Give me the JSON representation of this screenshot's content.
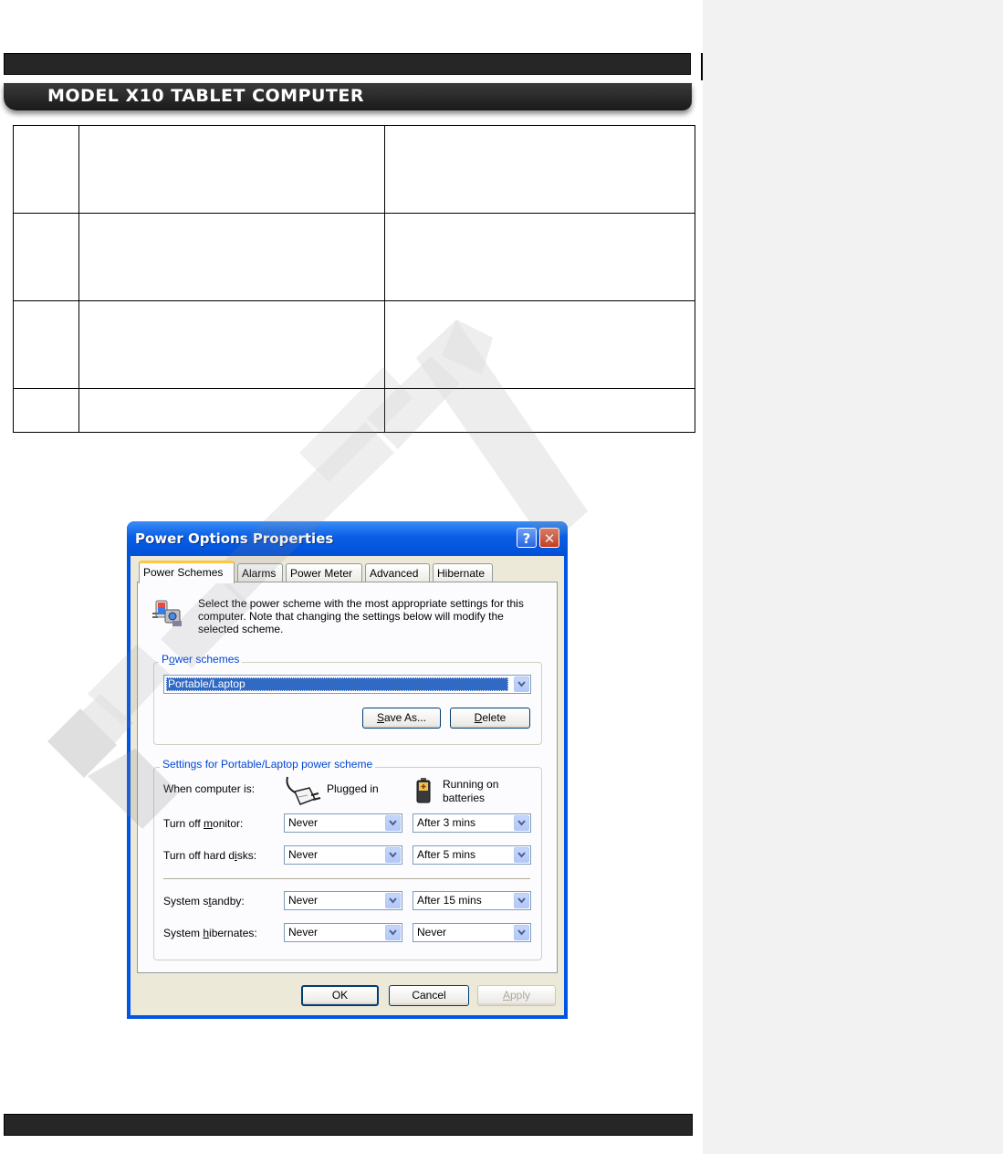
{
  "document": {
    "header_title": "MODEL X10 TABLET COMPUTER"
  },
  "dialog": {
    "title": "Power Options Properties",
    "help_glyph": "?",
    "close_glyph": "✕",
    "tabs": [
      {
        "label": "Power Schemes",
        "active": true
      },
      {
        "label": "Alarms",
        "active": false
      },
      {
        "label": "Power Meter",
        "active": false
      },
      {
        "label": "Advanced",
        "active": false
      },
      {
        "label": "Hibernate",
        "active": false
      }
    ],
    "description": "Select the power scheme with the most appropriate settings for this computer. Note that changing the settings below will modify the selected scheme.",
    "schemes_group": {
      "legend_prefix": "P",
      "legend_accel": "o",
      "legend_suffix": "wer schemes",
      "selected": "Portable/Laptop",
      "save_as": {
        "prefix": "",
        "accel": "S",
        "suffix": "ave As..."
      },
      "delete": {
        "prefix": "",
        "accel": "D",
        "suffix": "elete"
      }
    },
    "settings_group": {
      "legend": "Settings for Portable/Laptop power scheme",
      "when_label": "When computer is:",
      "plugged_label": "Plugged in",
      "battery_label_1": "Running on",
      "battery_label_2": "batteries",
      "rows": [
        {
          "label_prefix": "Turn off ",
          "label_accel": "m",
          "label_suffix": "onitor:",
          "plugged": "Never",
          "battery": "After 3 mins"
        },
        {
          "label_prefix": "Turn off hard d",
          "label_accel": "i",
          "label_suffix": "sks:",
          "plugged": "Never",
          "battery": "After 5 mins"
        },
        {
          "label_prefix": "System s",
          "label_accel": "t",
          "label_suffix": "andby:",
          "plugged": "Never",
          "battery": "After 15 mins"
        },
        {
          "label_prefix": "System ",
          "label_accel": "h",
          "label_suffix": "ibernates:",
          "plugged": "Never",
          "battery": "Never"
        }
      ]
    },
    "footer": {
      "ok": "OK",
      "cancel": "Cancel",
      "apply_accel": "A",
      "apply_suffix": "pply"
    }
  },
  "colors": {
    "accent_blue": "#0055e5",
    "dialog_face": "#ece9d8",
    "legend_blue": "#0046d5",
    "selection_blue": "#316ac5"
  },
  "icons": [
    "power-scheme-icon",
    "plug-icon",
    "battery-icon",
    "help-icon",
    "close-icon",
    "chevron-down-icon"
  ]
}
